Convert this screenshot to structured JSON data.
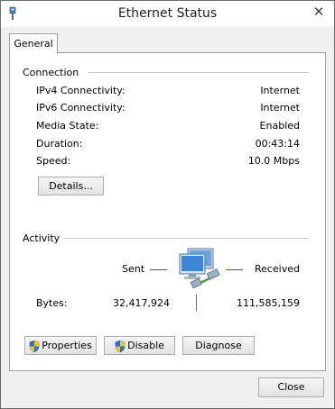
{
  "window": {
    "title": "Ethernet Status",
    "close_glyph": "✕"
  },
  "tabs": [
    {
      "label": "General"
    }
  ],
  "connection": {
    "heading": "Connection",
    "rows": [
      {
        "label": "IPv4 Connectivity:",
        "value": "Internet"
      },
      {
        "label": "IPv6 Connectivity:",
        "value": "Internet"
      },
      {
        "label": "Media State:",
        "value": "Enabled"
      },
      {
        "label": "Duration:",
        "value": "00:43:14"
      },
      {
        "label": "Speed:",
        "value": "10.0 Mbps"
      }
    ],
    "details_button": "Details..."
  },
  "activity": {
    "heading": "Activity",
    "sent_label": "Sent",
    "received_label": "Received",
    "bytes_label": "Bytes:",
    "bytes_sent": "32,417,924",
    "bytes_received": "111,585,159"
  },
  "buttons": {
    "properties": "Properties",
    "disable": "Disable",
    "diagnose": "Diagnose"
  },
  "footer": {
    "close": "Close"
  },
  "icons": {
    "title": "ethernet-plug-icon",
    "activity": "network-computers-icon",
    "shield": "uac-shield-icon"
  },
  "colors": {
    "rule": "#c8c8c8",
    "panel": "#ffffff",
    "window_bg": "#f0f0f0"
  }
}
